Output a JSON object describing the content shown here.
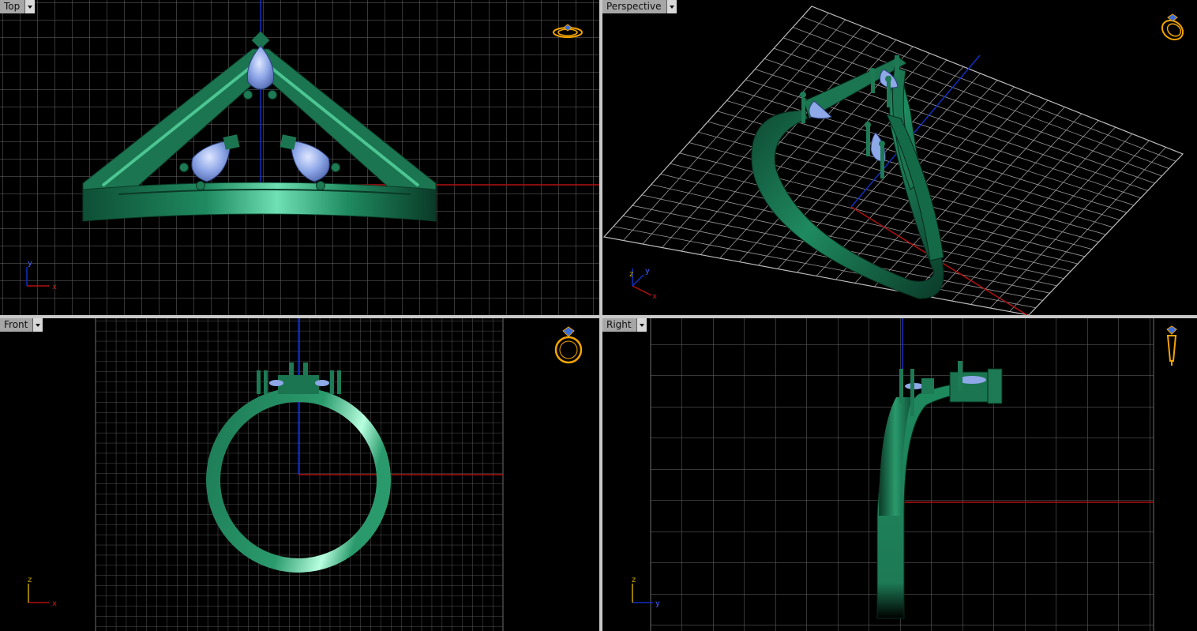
{
  "viewports": {
    "top": {
      "label": "Top",
      "axis_x": "x",
      "axis_y": "y"
    },
    "perspective": {
      "label": "Perspective",
      "axis_x": "x",
      "axis_y": "y",
      "axis_z": "z"
    },
    "front": {
      "label": "Front",
      "axis_x": "x",
      "axis_z": "z"
    },
    "right": {
      "label": "Right",
      "axis_y": "y",
      "axis_z": "z"
    }
  },
  "colors": {
    "viewport_bg": "#000000",
    "grid": "#6b6b6b",
    "x_axis": "#b01010",
    "y_axis": "#1030c0",
    "z_axis": "#1030c0",
    "ring_metal": "#1d7a55",
    "ring_highlight": "#6fe0b4",
    "gem": "#8fa8e8",
    "nav_icon": "#f2a400"
  },
  "icons": {
    "dropdown": "chevron-down-icon",
    "nav": "ring-navigation-icon"
  }
}
